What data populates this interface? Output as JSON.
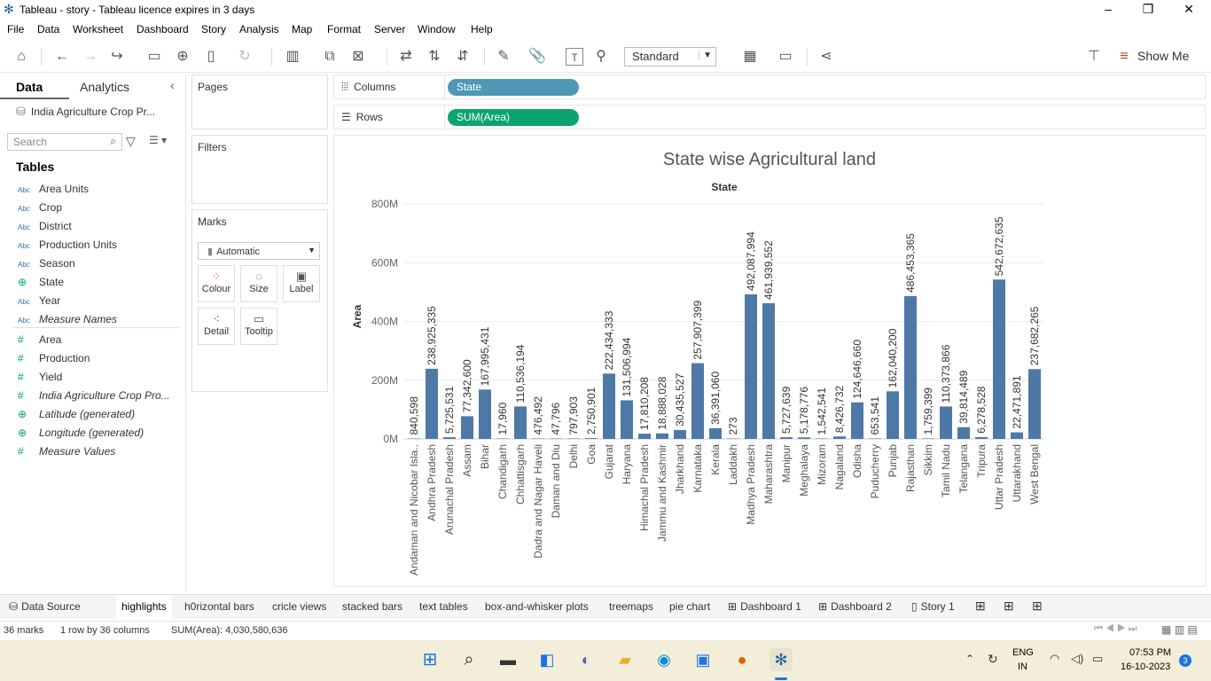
{
  "window": {
    "title": "Tableau - story - Tableau licence expires in 3 days"
  },
  "menu": [
    "File",
    "Data",
    "Worksheet",
    "Dashboard",
    "Story",
    "Analysis",
    "Map",
    "Format",
    "Server",
    "Window",
    "Help"
  ],
  "toolbar": {
    "fit_select": "Standard",
    "show_me": "Show Me"
  },
  "data_pane": {
    "tabs": [
      "Data",
      "Analytics"
    ],
    "datasource": "India Agriculture Crop Pr...",
    "search_placeholder": "Search",
    "tables_heading": "Tables",
    "fields": [
      {
        "type": "Abc",
        "label": "Area Units",
        "italic": false
      },
      {
        "type": "Abc",
        "label": "Crop",
        "italic": false
      },
      {
        "type": "Abc",
        "label": "District",
        "italic": false
      },
      {
        "type": "Abc",
        "label": "Production Units",
        "italic": false
      },
      {
        "type": "Abc",
        "label": "Season",
        "italic": false
      },
      {
        "type": "geo",
        "label": "State",
        "italic": false
      },
      {
        "type": "Abc",
        "label": "Year",
        "italic": false
      },
      {
        "type": "Abc",
        "label": "Measure Names",
        "italic": true
      },
      {
        "type": "#",
        "label": "Area",
        "italic": false
      },
      {
        "type": "#",
        "label": "Production",
        "italic": false
      },
      {
        "type": "#",
        "label": "Yield",
        "italic": false
      },
      {
        "type": "#",
        "label": "India Agriculture Crop Pro...",
        "italic": true
      },
      {
        "type": "geo",
        "label": "Latitude (generated)",
        "italic": true
      },
      {
        "type": "geo",
        "label": "Longitude (generated)",
        "italic": true
      },
      {
        "type": "#",
        "label": "Measure Values",
        "italic": true
      }
    ]
  },
  "cards": {
    "pages": "Pages",
    "filters": "Filters",
    "marks": "Marks",
    "mark_type": "Automatic",
    "mark_buttons": [
      "Colour",
      "Size",
      "Label",
      "Detail",
      "Tooltip"
    ]
  },
  "shelves": {
    "columns_label": "Columns",
    "columns_pill": "State",
    "rows_label": "Rows",
    "rows_pill": "SUM(Area)"
  },
  "chart_data": {
    "type": "bar",
    "title": "State wise Agricultural land",
    "column_header": "State",
    "ylabel": "Area",
    "ylim": [
      0,
      800000000
    ],
    "yticks": [
      "0M",
      "200M",
      "400M",
      "600M",
      "800M"
    ],
    "bar_color": "#4e79a7",
    "categories": [
      "Andaman and Nicobar Isla..",
      "Andhra Pradesh",
      "Arunachal Pradesh",
      "Assam",
      "Bihar",
      "Chandigarh",
      "Chhattisgarh",
      "Dadra and Nagar Haveli",
      "Daman and Diu",
      "Delhi",
      "Goa",
      "Gujarat",
      "Haryana",
      "Himachal Pradesh",
      "Jammu and Kashmir",
      "Jharkhand",
      "Karnataka",
      "Kerala",
      "Laddakh",
      "Madhya Pradesh",
      "Maharashtra",
      "Manipur",
      "Meghalaya",
      "Mizoram",
      "Nagaland",
      "Odisha",
      "Puducherry",
      "Punjab",
      "Rajasthan",
      "Sikkim",
      "Tamil Nadu",
      "Telangana",
      "Tripura",
      "Uttar Pradesh",
      "Uttarakhand",
      "West Bengal"
    ],
    "values": [
      840598,
      238925335,
      5725531,
      77342600,
      167995431,
      17960,
      110536194,
      476492,
      47796,
      797903,
      2750901,
      222434333,
      131506994,
      17810208,
      18888028,
      30435527,
      257907399,
      36391060,
      273,
      492087994,
      461939552,
      5727639,
      5178776,
      1542541,
      8426732,
      124646660,
      653541,
      162040200,
      486453365,
      1759399,
      110373866,
      39814489,
      6278528,
      542672635,
      22471891,
      237682265
    ],
    "labels": [
      "840,598",
      "238,925,335",
      "5,725,531",
      "77,342,600",
      "167,995,431",
      "17,960",
      "110,536,194",
      "476,492",
      "47,796",
      "797,903",
      "2,750,901",
      "222,434,333",
      "131,506,994",
      "17,810,208",
      "18,888,028",
      "30,435,527",
      "257,907,399",
      "36,391,060",
      "273",
      "492,087,994",
      "461,939,552",
      "5,727,639",
      "5,178,776",
      "1,542,541",
      "8,426,732",
      "124,646,660",
      "653,541",
      "162,040,200",
      "486,453,365",
      "1,759,399",
      "110,373,866",
      "39,814,489",
      "6,278,528",
      "542,672,635",
      "22,471,891",
      "237,682,265"
    ]
  },
  "sheet_tabs": [
    "Data Source",
    "highlights",
    "h0rizontal bars",
    "cricle views",
    "stacked bars",
    "text tables",
    "box-and-whisker plots",
    "treemaps",
    "pie chart",
    "Dashboard 1",
    "Dashboard 2",
    "Story 1"
  ],
  "active_tab": "highlights",
  "status": {
    "marks": "36 marks",
    "layout": "1 row  by  36 columns",
    "sum": "SUM(Area): 4,030,580,636"
  },
  "taskbar": {
    "lang": "ENG",
    "region": "IN",
    "time": "07:53 PM",
    "date": "16-10-2023",
    "notifications": "3"
  }
}
